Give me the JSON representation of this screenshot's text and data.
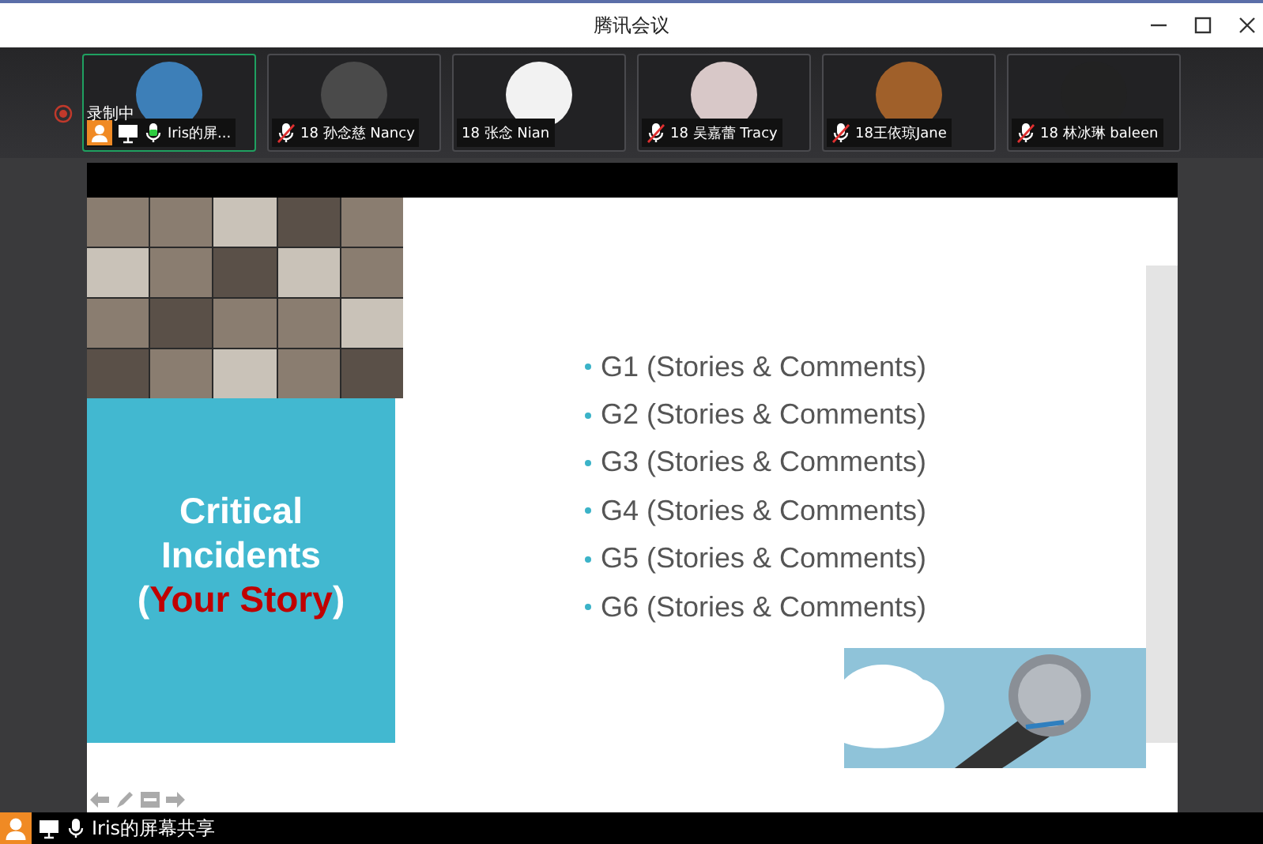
{
  "window": {
    "title": "腾讯会议"
  },
  "recording": {
    "label": "录制中"
  },
  "participants": [
    {
      "name": "Iris的屏...",
      "selected": true,
      "kind": "self"
    },
    {
      "name": "18 孙念慈 Nancy",
      "selected": false,
      "kind": "muted"
    },
    {
      "name": "18 张念 Nian",
      "selected": false,
      "kind": "plain"
    },
    {
      "name": "18 吴嘉蕾 Tracy",
      "selected": false,
      "kind": "muted"
    },
    {
      "name": "18王依琼Jane",
      "selected": false,
      "kind": "muted"
    },
    {
      "name": "18 林冰琳 baleen",
      "selected": false,
      "kind": "muted"
    }
  ],
  "slide": {
    "title_lines": [
      "Critical",
      "Incidents"
    ],
    "subtitle": {
      "before": "(",
      "highlight": "Your Story",
      "after": ")"
    },
    "bullets": [
      "G1 (Stories & Comments)",
      "G2 (Stories & Comments)",
      "G3 (Stories & Comments)",
      "G4 (Stories & Comments)",
      "G5 (Stories & Comments)",
      "G6 (Stories & Comments)"
    ]
  },
  "share_bar": {
    "label": "Iris的屏幕共享"
  }
}
